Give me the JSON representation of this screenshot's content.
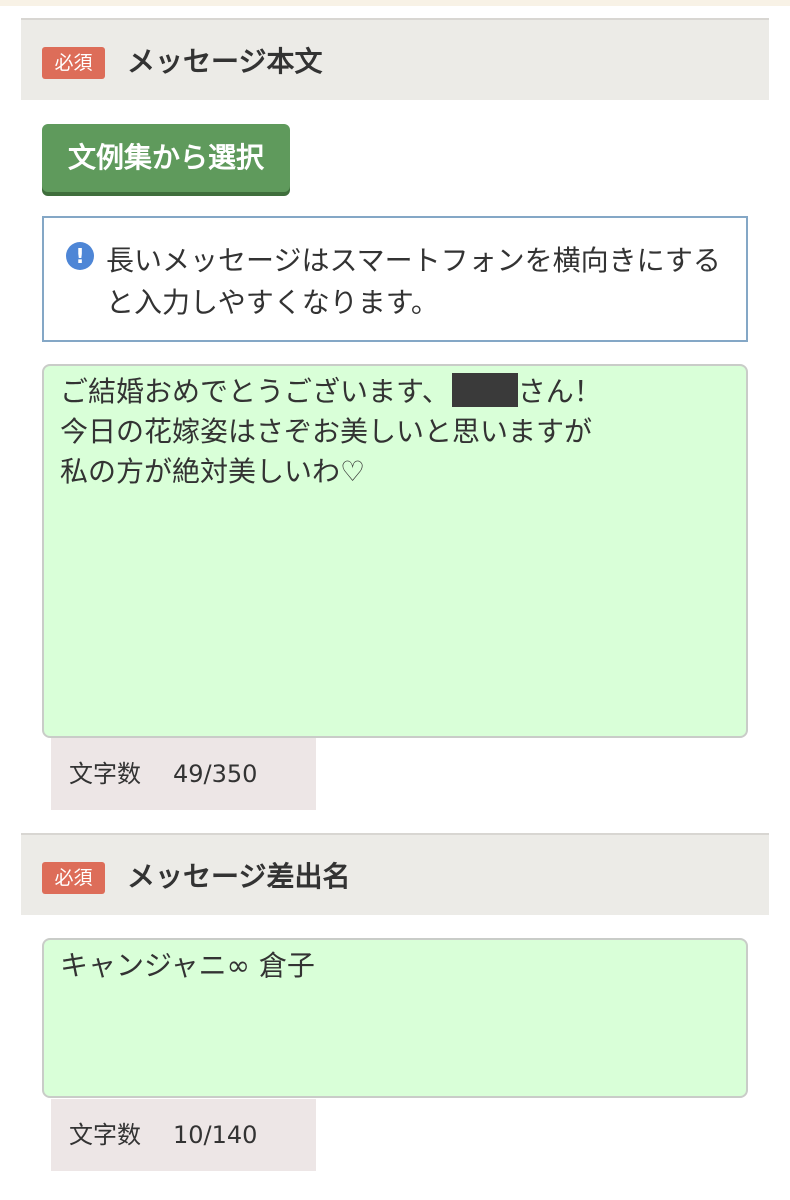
{
  "message_section": {
    "required_badge": "必須",
    "title": "メッセージ本文",
    "template_button_label": "文例集から選択",
    "notice": {
      "icon": "exclamation-info-icon",
      "text": "長いメッセージはスマートフォンを横向きにすると入力しやすくなります。"
    },
    "message": {
      "line1_before": "ご結婚おめでとうございます、",
      "line1_after": "さん！",
      "line2": "今日の花嫁姿はさぞお美しいと思いますが",
      "line3": "私の方が絶対美しいわ♡"
    },
    "counter_label": "文字数",
    "counter_value": "49/350"
  },
  "sender_section": {
    "required_badge": "必須",
    "title": "メッセージ差出名",
    "sender_name": "キャンジャニ∞ 倉子",
    "counter_label": "文字数",
    "counter_value": "10/140"
  },
  "colors": {
    "badge": "#dd6d59",
    "button": "#5f9a5c",
    "textarea_bg": "#d9ffd8",
    "notice_border": "#84a7c6",
    "info_icon": "#4e86d6"
  }
}
